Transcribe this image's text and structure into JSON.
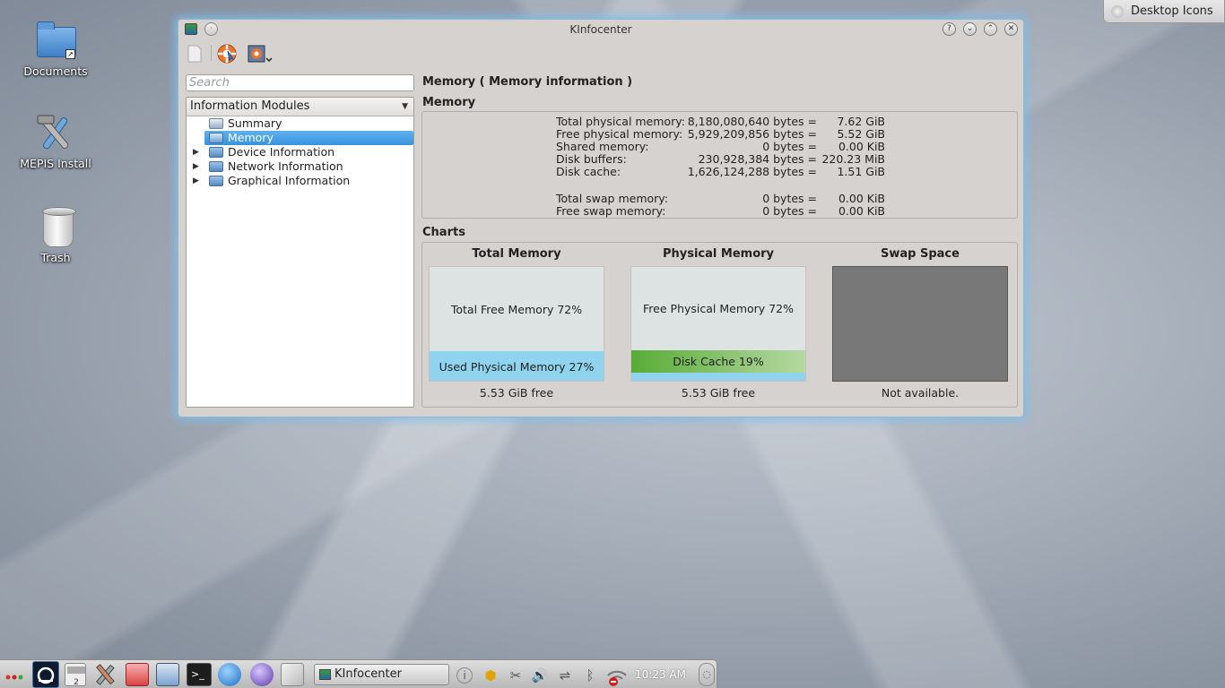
{
  "desktop": {
    "icons": [
      {
        "label": "Documents"
      },
      {
        "label": "MEPIS Install"
      },
      {
        "label": "Trash"
      }
    ],
    "desktop_icons_button": "Desktop Icons"
  },
  "window": {
    "title": "KInfocenter",
    "search_placeholder": "Search",
    "sidebar": {
      "combo_label": "Information Modules",
      "items": [
        {
          "label": "Summary",
          "expandable": false
        },
        {
          "label": "Memory",
          "expandable": false,
          "selected": true
        },
        {
          "label": "Device Information",
          "expandable": true
        },
        {
          "label": "Network Information",
          "expandable": true
        },
        {
          "label": "Graphical Information",
          "expandable": true
        }
      ]
    },
    "main": {
      "heading": "Memory  ( Memory information )",
      "memory_group": "Memory",
      "rows": [
        {
          "key": "Total physical memory:",
          "bytes": "8,180,080,640 bytes =",
          "value": "7.62 GiB"
        },
        {
          "key": "Free physical memory:",
          "bytes": "5,929,209,856 bytes =",
          "value": "5.52 GiB"
        },
        {
          "key": "Shared memory:",
          "bytes": "0 bytes =",
          "value": "0.00 KiB"
        },
        {
          "key": "Disk buffers:",
          "bytes": "230,928,384 bytes =",
          "value": "220.23 MiB"
        },
        {
          "key": "Disk cache:",
          "bytes": "1,626,124,288 bytes =",
          "value": "1.51 GiB"
        },
        {
          "key": "Total swap memory:",
          "bytes": "0 bytes =",
          "value": "0.00 KiB"
        },
        {
          "key": "Free swap memory:",
          "bytes": "0 bytes =",
          "value": "0.00 KiB"
        }
      ],
      "charts_group": "Charts",
      "charts": [
        {
          "title": "Total Memory",
          "caption": "5.53 GiB free",
          "free_label": "Total Free Memory 72%",
          "used_label": "Used Physical Memory 27%",
          "free_pct": 72,
          "used_pct": 27
        },
        {
          "title": "Physical Memory",
          "caption": "5.53 GiB free",
          "free_label": "Free Physical Memory 72%",
          "cache_label": "Disk Cache 19%",
          "free_pct": 72,
          "cache_pct": 19
        },
        {
          "title": "Swap Space",
          "caption": "Not available."
        }
      ]
    }
  },
  "taskbar": {
    "task_label": "KInfocenter",
    "clock": "10:23 AM",
    "pager_number": "2"
  },
  "colors": {
    "selection": "#3b92dc",
    "used_memory": "#8fd3ef",
    "disk_cache": "#5aae3b",
    "swap_na": "#787878",
    "window_glow": "#78bef0"
  }
}
